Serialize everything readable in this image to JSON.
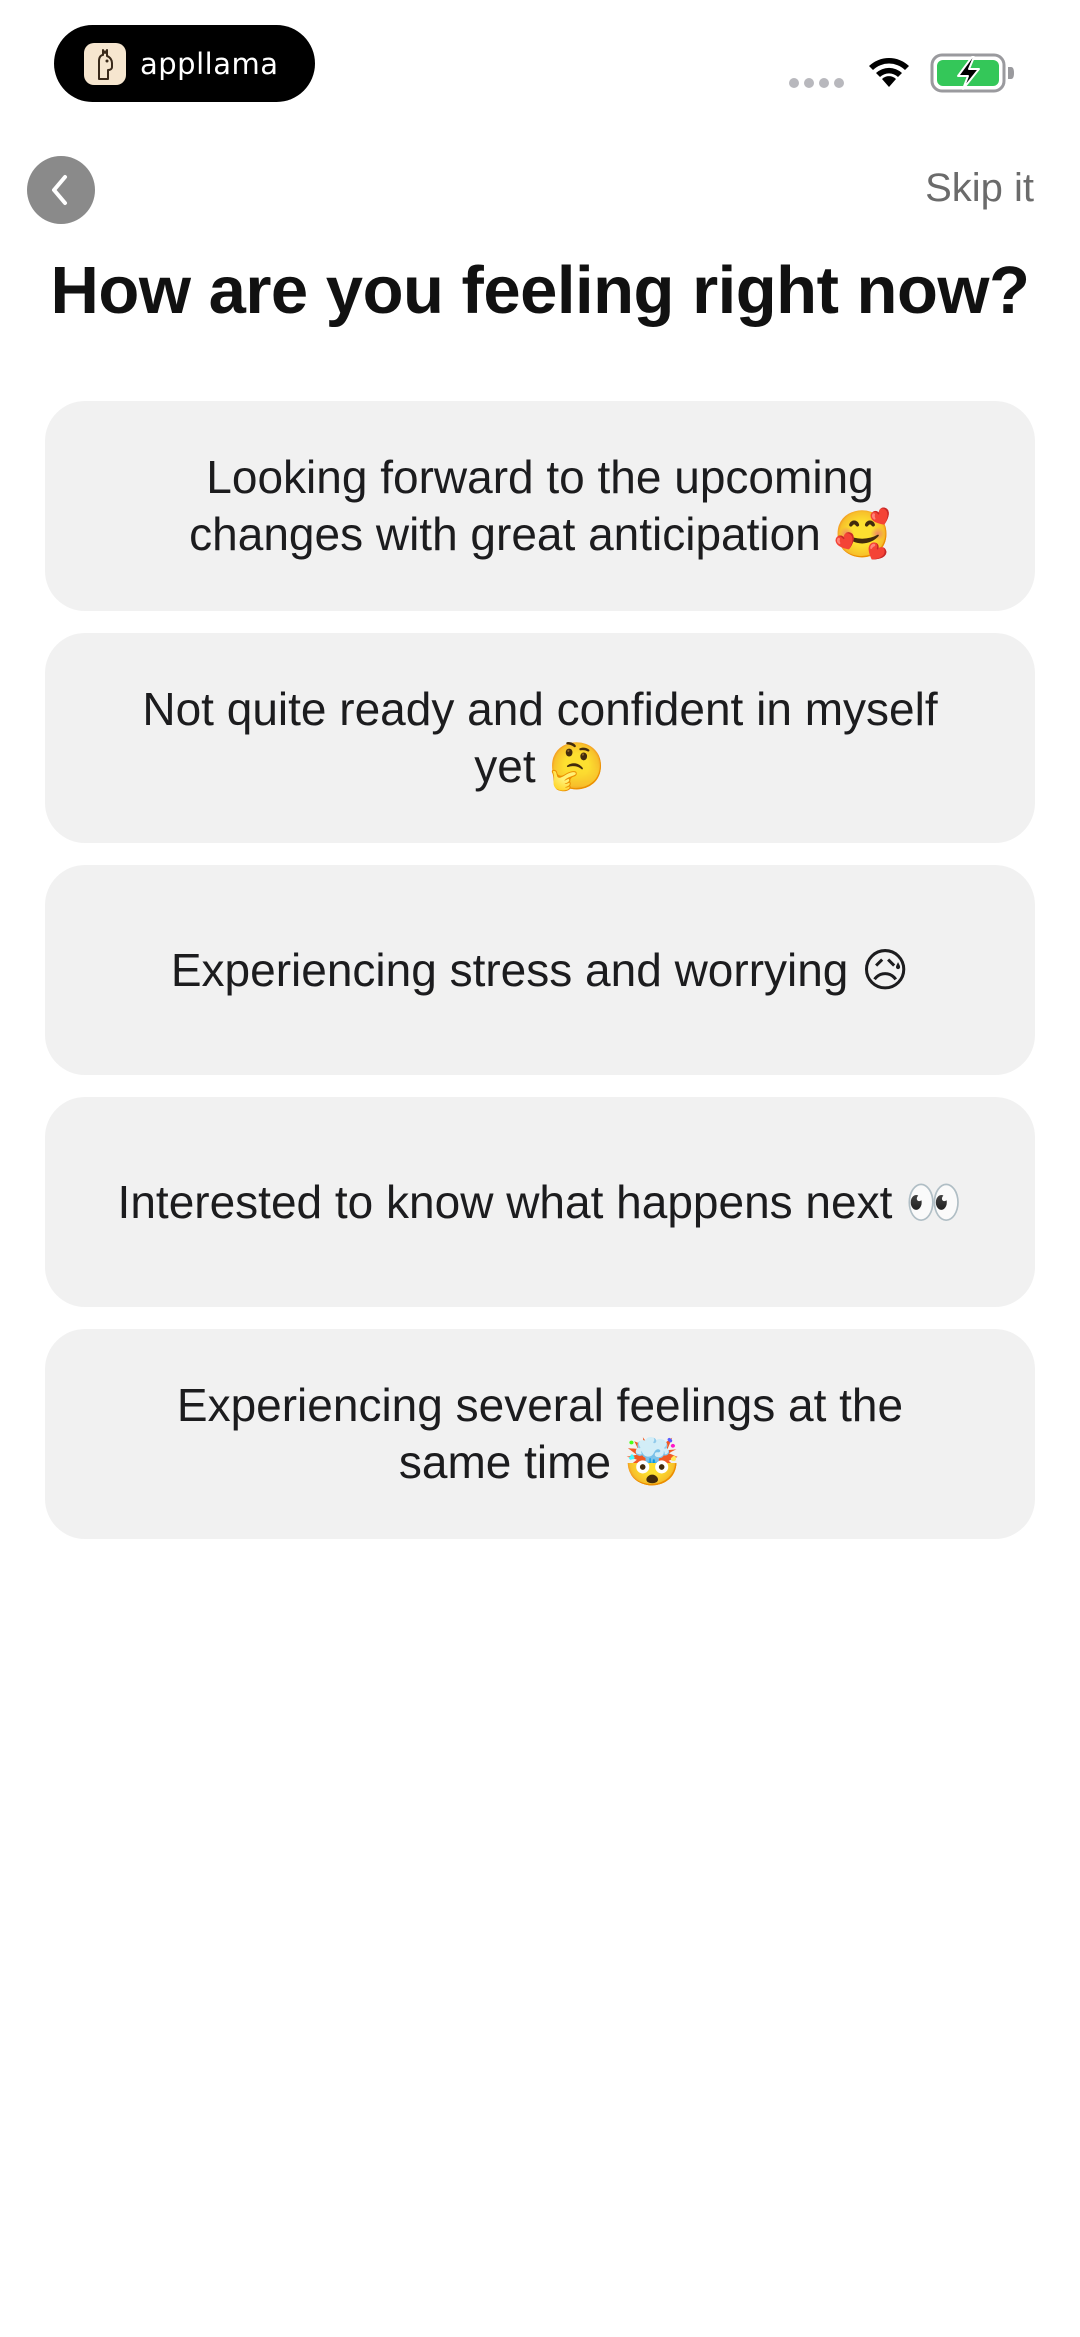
{
  "status_bar": {
    "app_badge": {
      "name": "appllama",
      "icon": "llama-logo-icon"
    },
    "signal_icon": "cellular-signal-dots-icon",
    "wifi_icon": "wifi-icon",
    "battery_icon": "battery-charging-icon",
    "battery_color": "#34c759"
  },
  "nav": {
    "back_icon": "chevron-left-icon",
    "skip_label": "Skip it"
  },
  "question": {
    "title": "How are you feeling right now?"
  },
  "options": [
    {
      "label": "Looking forward to the upcoming changes with great anticipation 🥰"
    },
    {
      "label": "Not quite ready and confident in myself yet 🤔"
    },
    {
      "label": "Experiencing stress and worrying 😥"
    },
    {
      "label": "Interested to know what happens next 👀"
    },
    {
      "label": "Experiencing several feelings at the same time 🤯"
    }
  ],
  "colors": {
    "option_background": "#f1f1f1",
    "back_button": "#8a8a8a",
    "skip_text": "#6b6b6b",
    "title_text": "#111111"
  }
}
